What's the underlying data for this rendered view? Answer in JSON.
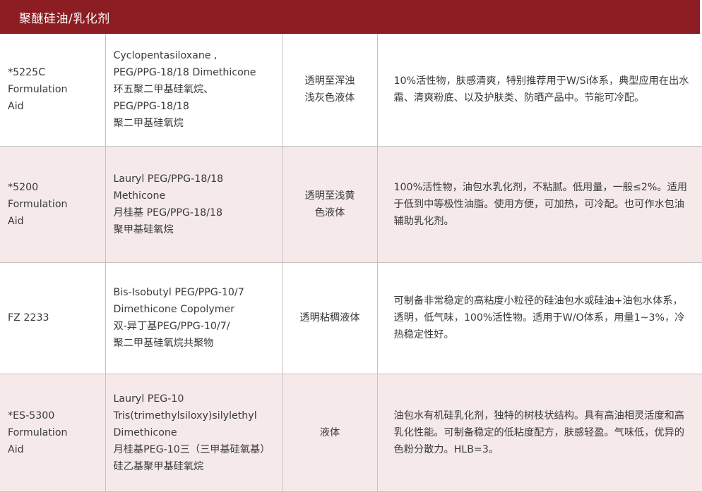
{
  "header": {
    "title": "聚醚硅油/乳化剂"
  },
  "rows": [
    {
      "name": "*5225C\n Formulation\n Aid",
      "inci": "Cyclopentasiloxane ,\nPEG/PPG-18/18 Dimethicone\n环五聚二甲基硅氧烷、\nPEG/PPG-18/18\n聚二甲基硅氧烷",
      "appearance": "透明至浑浊\n浅灰色液体",
      "description": "10%活性物，肤感清爽，特别推荐用于W/Si体系，典型应用在出水霜、清爽粉底、以及护肤类、防晒产品中。节能可冷配。"
    },
    {
      "name": "*5200\n Formulation\n Aid",
      "inci": "Lauryl PEG/PPG-18/18\nMethicone\n月桂基 PEG/PPG-18/18\n聚甲基硅氧烷",
      "appearance": "透明至浅黄\n色液体",
      "description": "100%活性物，油包水乳化剂，不粘腻。低用量，一般≤2%。适用于低到中等极性油脂。使用方便，可加热，可冷配。也可作水包油辅助乳化剂。"
    },
    {
      "name": " FZ 2233",
      "inci": "Bis-Isobutyl PEG/PPG-10/7\nDimethicone Copolymer\n双-异丁基PEG/PPG-10/7/\n聚二甲基硅氧烷共聚物",
      "appearance": "透明粘稠液体",
      "description": "可制备非常稳定的高粘度小粒径的硅油包水或硅油+油包水体系，透明，低气味，100%活性物。适用于W/O体系，用量1~3%，冷热稳定性好。"
    },
    {
      "name": "*ES-5300\n Formulation\n Aid",
      "inci": "Lauryl PEG-10\nTris(trimethylsiloxy)silylethyl\nDimethicone\n月桂基PEG-10三（三甲基硅氧基）\n硅乙基聚甲基硅氧烷",
      "appearance": "液体",
      "description": "油包水有机硅乳化剂，独特的树枝状结构。具有高油相灵活度和高乳化性能。可制备稳定的低粘度配方，肤感轻盈。气味低，优异的色粉分散力。HLB=3。"
    }
  ]
}
